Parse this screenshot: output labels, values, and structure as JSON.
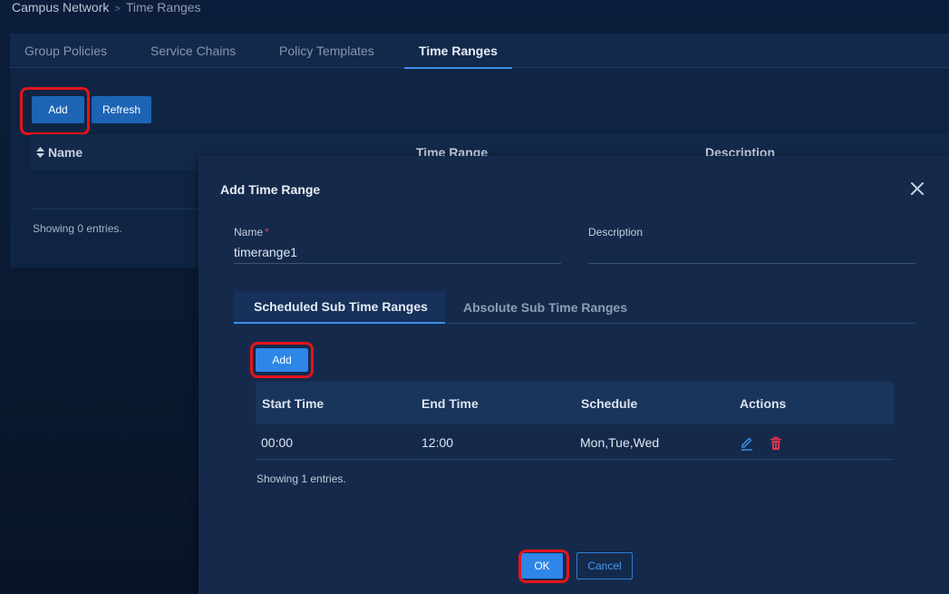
{
  "breadcrumb": {
    "root": "Campus Network",
    "separator": ">",
    "current": "Time Ranges"
  },
  "tabs": [
    {
      "label": "Group Policies"
    },
    {
      "label": "Service Chains"
    },
    {
      "label": "Policy Templates"
    },
    {
      "label": "Time Ranges",
      "active": true
    }
  ],
  "toolbar": {
    "add_label": "Add",
    "refresh_label": "Refresh"
  },
  "main_table": {
    "columns": [
      "Name",
      "Time Range",
      "Description"
    ],
    "sort_icon": "sort-icon",
    "showing": "Showing 0 entries."
  },
  "modal": {
    "title": "Add Time Range",
    "close_icon": "close-icon",
    "name_label": "Name",
    "required_mark": "*",
    "name_value": "timerange1",
    "description_label": "Description",
    "description_value": "",
    "sub_tabs": [
      {
        "label": "Scheduled Sub Time Ranges",
        "active": true
      },
      {
        "label": "Absolute Sub Time Ranges"
      }
    ],
    "add_label": "Add",
    "table": {
      "columns": [
        "Start Time",
        "End Time",
        "Schedule",
        "Actions"
      ],
      "rows": [
        {
          "start": "00:00",
          "end": "12:00",
          "schedule": "Mon,Tue,Wed",
          "actions": [
            "edit-icon",
            "delete-icon"
          ]
        }
      ],
      "showing": "Showing 1 entries."
    },
    "ok_label": "OK",
    "cancel_label": "Cancel"
  },
  "colors": {
    "accent": "#2d86e8",
    "highlight": "#e4141c",
    "delete": "#e8354a",
    "edit": "#3a8ee6"
  }
}
